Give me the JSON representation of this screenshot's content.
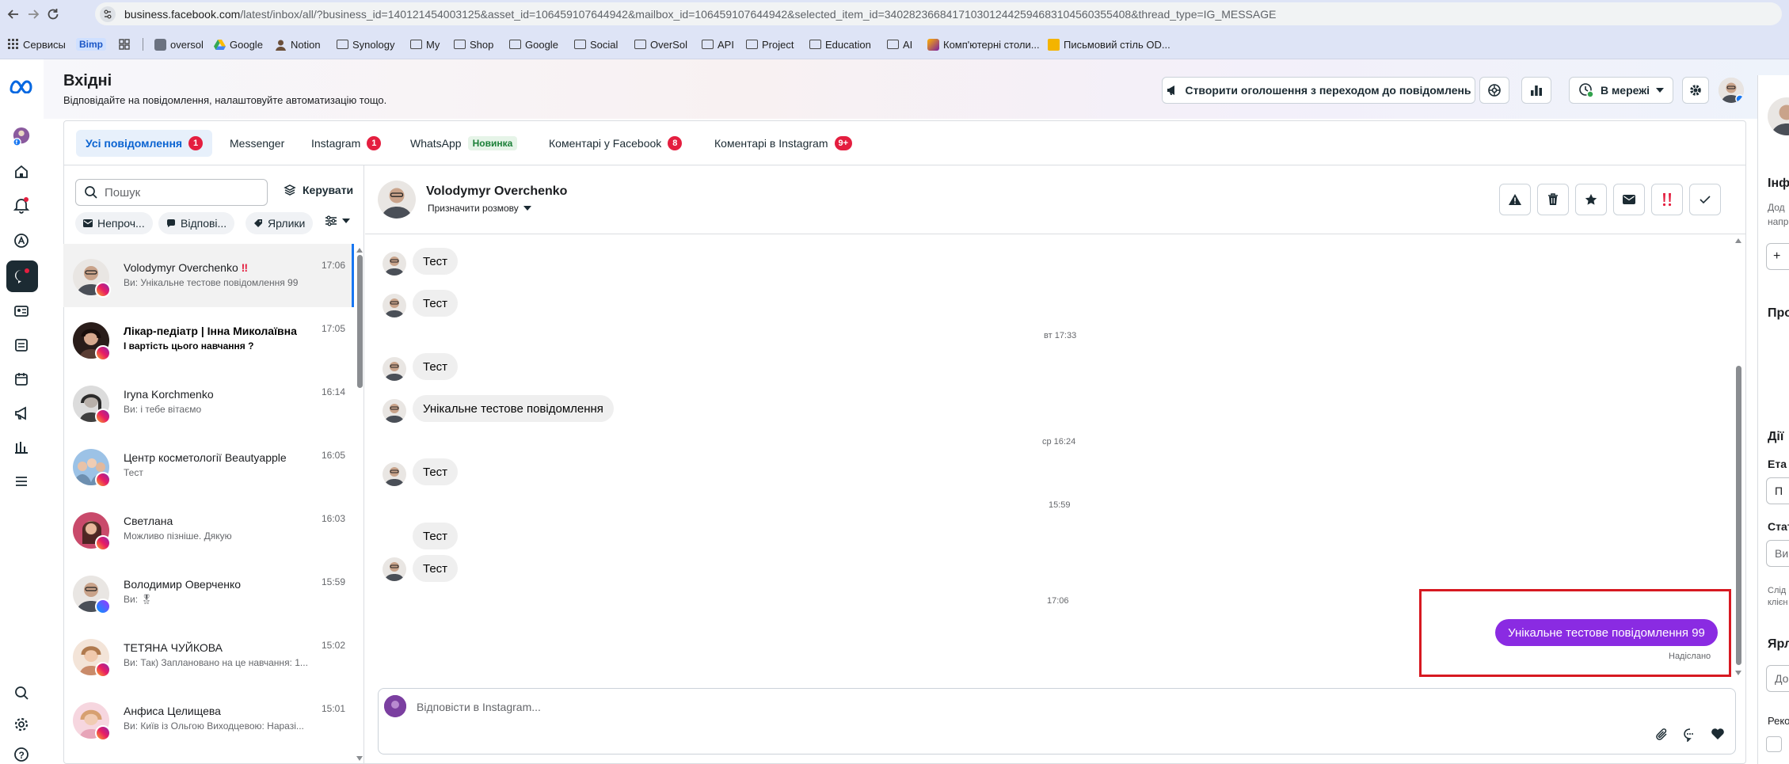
{
  "browser": {
    "url_host": "business.facebook.com",
    "url_path": "/latest/inbox/all/?business_id=140121454003125&asset_id=106459107644942&mailbox_id=106459107644942&selected_item_id=3402823668417103012442594683104560355408&thread_type=IG_MESSAGE",
    "bookmarks": [
      "Сервисы",
      "Bimp",
      "oversol",
      "Google",
      "Notion",
      "Synology",
      "My",
      "Shop",
      "Google",
      "Social",
      "OverSol",
      "API",
      "Project",
      "Education",
      "AI",
      "Комп'ютерні столи...",
      "Письмовий стіль OD..."
    ]
  },
  "header": {
    "title": "Вхідні",
    "subtitle": "Відповідайте на повідомлення, налаштовуйте автоматизацію тощо.",
    "create_ad_label": "Створити оголошення з переходом до повідомлень",
    "status_label": "В мережі"
  },
  "tabs": [
    {
      "label": "Усі повідомлення",
      "badge": "1"
    },
    {
      "label": "Messenger",
      "badge": ""
    },
    {
      "label": "Instagram",
      "badge": "1"
    },
    {
      "label": "WhatsApp",
      "badge": "Новинка"
    },
    {
      "label": "Коментарі у Facebook",
      "badge": "8"
    },
    {
      "label": "Коментарі в Instagram",
      "badge": "9+"
    }
  ],
  "list": {
    "search_placeholder": "Пошук",
    "manage_label": "Керувати",
    "filters": [
      "Непроч...",
      "Відпові...",
      "Ярлики"
    ],
    "conversations": [
      {
        "name": "Volodymyr Overchenko",
        "preview": "Ви: Унікальне тестове повідомлення 99",
        "time": "17:06",
        "platform": "instagram",
        "unread": false
      },
      {
        "name": "Лікар-педіатр | Інна Миколаївна",
        "preview": "І вартість цього навчання ?",
        "time": "17:05",
        "platform": "instagram",
        "unread": true
      },
      {
        "name": "Iryna Korchmenko",
        "preview": "Ви: і тебе вітаємо",
        "time": "16:14",
        "platform": "instagram",
        "unread": false
      },
      {
        "name": "Центр косметології Beautyapple",
        "preview": "Тест",
        "time": "16:05",
        "platform": "instagram",
        "unread": false
      },
      {
        "name": "Светлана",
        "preview": "Можливо пізніше. Дякую",
        "time": "16:03",
        "platform": "instagram",
        "unread": false
      },
      {
        "name": "Володимир Оверченко",
        "preview": "Ви: 🎖",
        "time": "15:59",
        "platform": "messenger",
        "unread": false
      },
      {
        "name": "ТЕТЯНА ЧУЙКОВА",
        "preview": "Ви: Так) Заплановано на це навчання: 1...",
        "time": "15:02",
        "platform": "instagram",
        "unread": false
      },
      {
        "name": "Анфиса Целищева",
        "preview": "Ви: Київ із Ольгою Виходцевою: Наразі...",
        "time": "15:01",
        "platform": "instagram",
        "unread": false
      }
    ]
  },
  "chat": {
    "contact_name": "Volodymyr Overchenko",
    "assign_label": "Призначити розмову",
    "messages_in": [
      "Тест",
      "Тест",
      "Тест",
      "Унікальне тестове повідомлення",
      "Тест",
      "Тест",
      "Тест"
    ],
    "separators": [
      "вт 17:33",
      "ср 16:24",
      "15:59",
      "17:06"
    ],
    "message_out": "Унікальне тестове повідомлення 99",
    "sent_label": "Надіслано",
    "composer_placeholder": "Відповісти в Instagram..."
  },
  "right_panel": {
    "items": [
      "Інф",
      "Дод",
      "напр",
      "Про",
      "Дії",
      "Ета",
      "П",
      "Стат",
      "Ви",
      "Слід",
      "клієн",
      "Ярл",
      "До",
      "Реко"
    ]
  },
  "colors": {
    "accent": "#1877f2",
    "outgoing_bubble": "#8a2be2",
    "badge": "#e41e3f",
    "highlight": "#d71921"
  }
}
